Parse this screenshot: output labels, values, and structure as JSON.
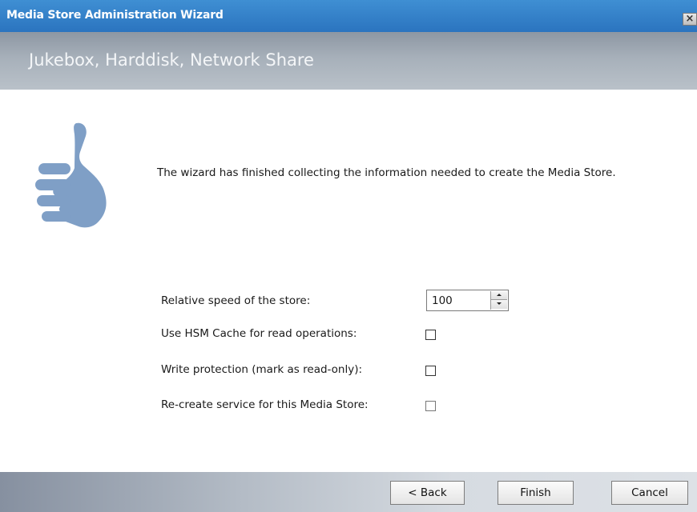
{
  "window": {
    "title": "Media Store Administration Wizard",
    "close_glyph": "×"
  },
  "header": {
    "subtitle": "Jukebox, Harddisk, Network Share"
  },
  "main": {
    "message": "The wizard has finished collecting the information needed to create the Media Store.",
    "icon": "thumbs-up-icon",
    "options": {
      "relative_speed_label": "Relative speed of the store:",
      "relative_speed_value": "100",
      "hsm_cache_label": "Use HSM Cache for read operations:",
      "hsm_cache_checked": false,
      "write_protection_label": "Write protection (mark as read-only):",
      "write_protection_checked": false,
      "recreate_service_label": "Re-create service for this Media Store:",
      "recreate_service_checked": false
    }
  },
  "footer": {
    "back_label": "< Back",
    "finish_label": "Finish",
    "cancel_label": "Cancel"
  },
  "colors": {
    "titlebar": "#2f7cc6",
    "icon": "#7f9fc6"
  }
}
